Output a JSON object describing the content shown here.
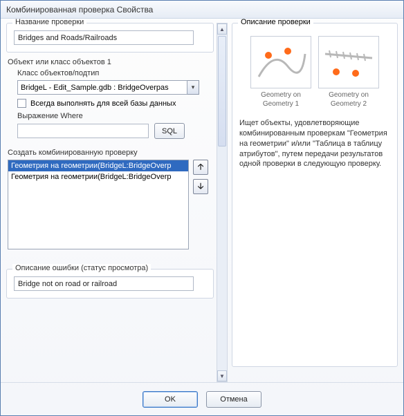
{
  "window": {
    "title": "Комбинированная проверка Свойства"
  },
  "left": {
    "check_name_group": "Название проверки",
    "check_name_value": "Bridges and Roads/Railroads",
    "feature_group": "Объект или класс объектов 1",
    "feature_sublabel": "Класс объектов/подтип",
    "combo_value": "BridgeL - Edit_Sample.gdb : BridgeOverpas",
    "always_run_label": "Всегда выполнять для всей базы данных",
    "where_label": "Выражение Where",
    "where_value": "",
    "sql_label": "SQL",
    "create_group": "Создать комбинированную проверку",
    "list_items": [
      "Геометрия на геометрии(BridgeL:BridgeOverp",
      "Геометрия на геометрии(BridgeL:BridgeOverp"
    ],
    "error_group": "Описание ошибки (статус просмотра)",
    "error_value": "Bridge not on road or railroad"
  },
  "right": {
    "legend": "Описание проверки",
    "thumbs": [
      {
        "label": "Geometry on Geometry 1"
      },
      {
        "label": "Geometry on Geometry 2"
      }
    ],
    "description": "Ищет объекты, удовлетворяющие комбинированным проверкам \"Геометрия на геометрии\" и/или \"Таблица в таблицу атрибутов\", путем передачи результатов одной проверки в следующую проверку."
  },
  "footer": {
    "ok": "OK",
    "cancel": "Отмена"
  }
}
